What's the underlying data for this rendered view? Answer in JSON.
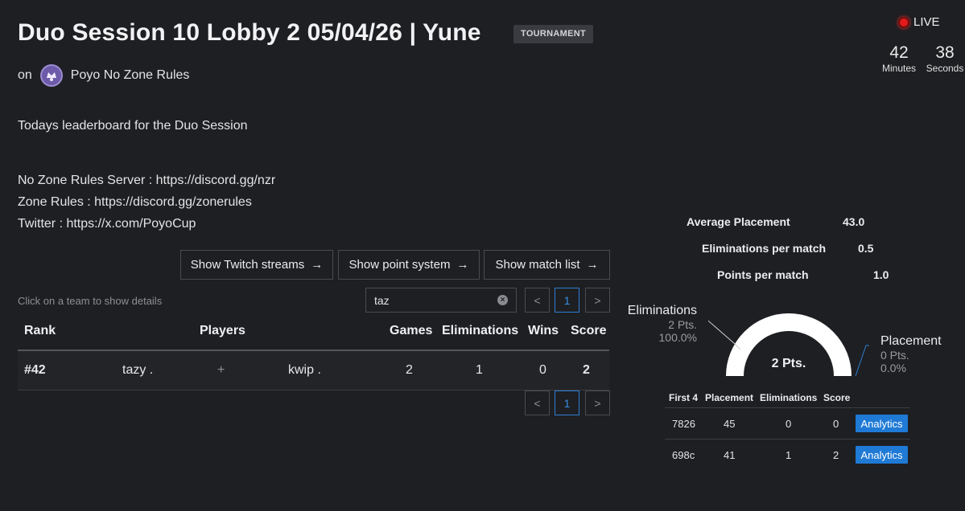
{
  "header": {
    "title": "Duo Session 10 Lobby 2 05/04/26 | Yune",
    "badge": "TOURNAMENT",
    "on_label": "on",
    "org_name": "Poyo No Zone Rules"
  },
  "live": {
    "label": "LIVE",
    "minutes": "42",
    "minutes_label": "Minutes",
    "seconds": "38",
    "seconds_label": "Seconds"
  },
  "description": {
    "line1": "Todays leaderboard for the Duo Session",
    "line2": "No Zone Rules Server : https://discord.gg/nzr",
    "line3": "Zone Rules : https://discord.gg/zonerules",
    "line4": "Twitter : https://x.com/PoyoCup"
  },
  "buttons": {
    "twitch": "Show Twitch streams",
    "points": "Show point system",
    "matches": "Show match list",
    "arrow": "→"
  },
  "hint": "Click on a team to show details",
  "search": {
    "value": "taz",
    "clear": "×"
  },
  "pagination": {
    "prev": "<",
    "page": "1",
    "next": ">"
  },
  "table": {
    "headers": {
      "rank": "Rank",
      "players": "Players",
      "games": "Games",
      "elims": "Eliminations",
      "wins": "Wins",
      "score": "Score"
    },
    "rows": [
      {
        "rank": "#42",
        "player1": "tazy .",
        "plus": "+",
        "player2": "kwip .",
        "games": "2",
        "elims": "1",
        "wins": "0",
        "score": "2"
      }
    ]
  },
  "stats": {
    "avg_placement_label": "Average Placement",
    "avg_placement_value": "43.0",
    "elims_per_match_label": "Eliminations per match",
    "elims_per_match_value": "0.5",
    "points_per_match_label": "Points per match",
    "points_per_match_value": "1.0"
  },
  "gauge": {
    "center": "2 Pts.",
    "elims_label": "Eliminations",
    "elims_pts": "2 Pts.",
    "elims_pct": "100.0%",
    "elims_fraction": 1.0,
    "placement_label": "Placement",
    "placement_pts": "0 Pts.",
    "placement_pct": "0.0%",
    "colors": {
      "elims": "#ffffff",
      "placement": "#2d7fd4"
    }
  },
  "matches": {
    "headers": {
      "id": "First 4",
      "placement": "Placement",
      "elims": "Eliminations",
      "score": "Score"
    },
    "rows": [
      {
        "id": "7826",
        "placement": "45",
        "elims": "0",
        "score": "0",
        "action": "Analytics"
      },
      {
        "id": "698c",
        "placement": "41",
        "elims": "1",
        "score": "2",
        "action": "Analytics"
      }
    ]
  }
}
